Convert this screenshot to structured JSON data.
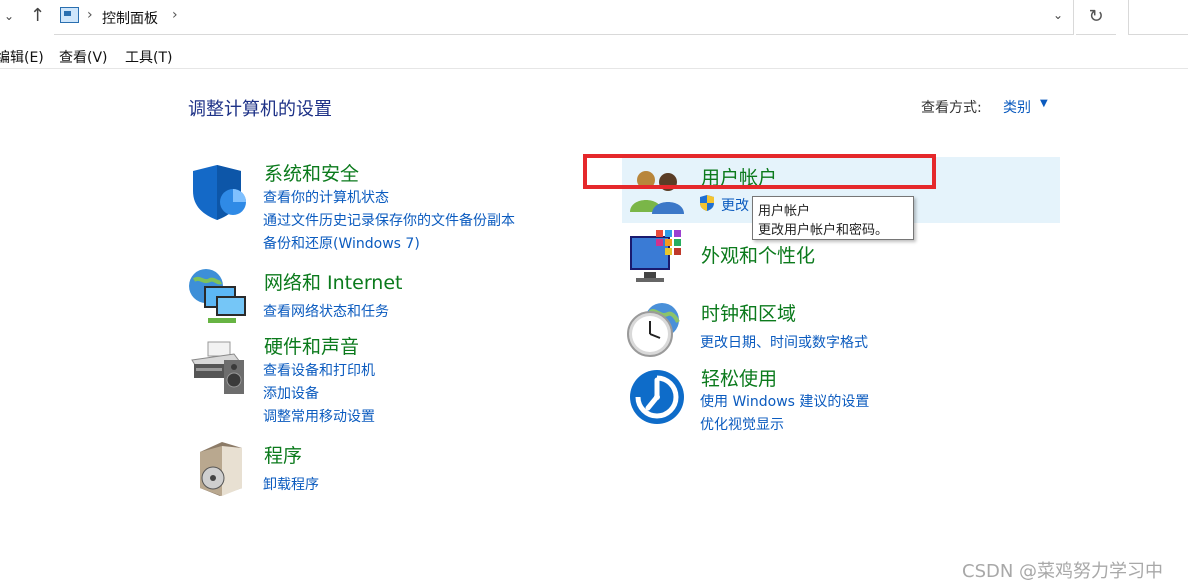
{
  "address_bar": {
    "breadcrumb": "控制面板"
  },
  "menu": {
    "edit": "编辑(E)",
    "view": "查看(V)",
    "tools": "工具(T)"
  },
  "page_title": "调整计算机的设置",
  "view_mode": {
    "label": "查看方式:",
    "value": "类别"
  },
  "categories": [
    {
      "title": "系统和安全",
      "links": [
        "查看你的计算机状态",
        "通过文件历史记录保存你的文件备份副本",
        "备份和还原(Windows 7)"
      ]
    },
    {
      "title": "网络和 Internet",
      "links": [
        "查看网络状态和任务"
      ]
    },
    {
      "title": "硬件和声音",
      "links": [
        "查看设备和打印机",
        "添加设备",
        "调整常用移动设置"
      ]
    },
    {
      "title": "程序",
      "links": [
        "卸载程序"
      ]
    },
    {
      "title": "用户帐户",
      "links": [
        "更改"
      ]
    },
    {
      "title": "外观和个性化",
      "links": []
    },
    {
      "title": "时钟和区域",
      "links": [
        "更改日期、时间或数字格式"
      ]
    },
    {
      "title": "轻松使用",
      "links": [
        "使用 Windows 建议的设置",
        "优化视觉显示"
      ]
    }
  ],
  "tooltip": {
    "title": "用户帐户",
    "desc": "更改用户帐户和密码。"
  },
  "watermark": "CSDN @菜鸡努力学习中",
  "colors": {
    "category_title": "#0b7a1c",
    "link": "#0b5bbf",
    "page_title": "#1e3287",
    "highlight_box": "#e5282b",
    "hover_bg": "#e5f3fb"
  }
}
